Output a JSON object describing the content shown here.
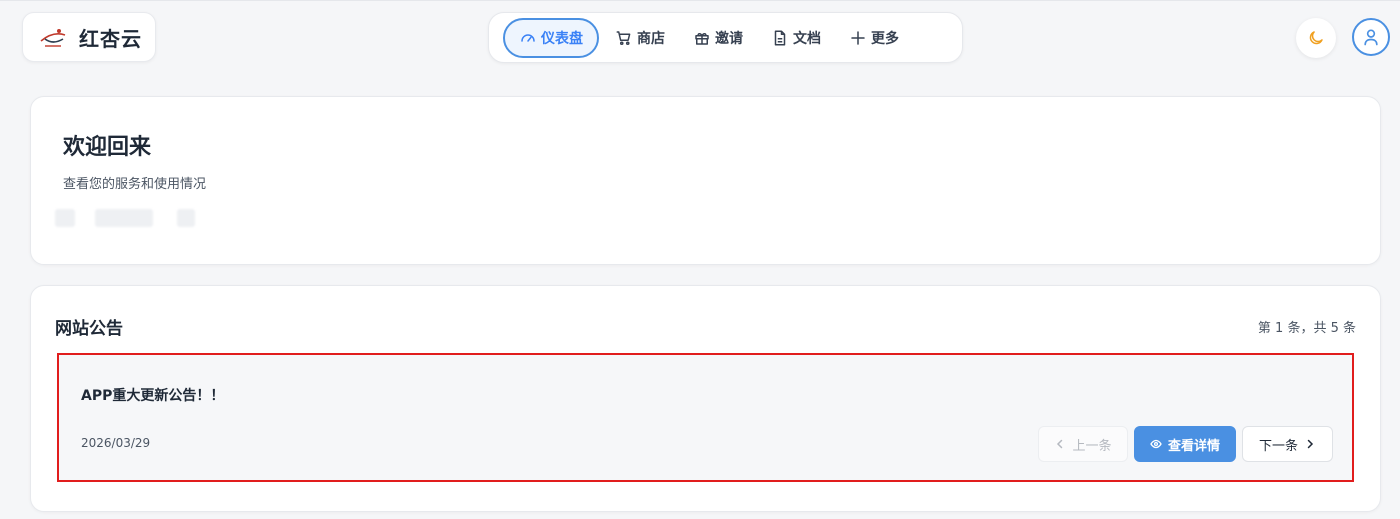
{
  "app": {
    "name": "红杏云"
  },
  "nav": {
    "items": [
      {
        "label": "仪表盘",
        "icon": "gauge-icon",
        "active": true
      },
      {
        "label": "商店",
        "icon": "cart-icon",
        "active": false
      },
      {
        "label": "邀请",
        "icon": "gift-icon",
        "active": false
      },
      {
        "label": "文档",
        "icon": "document-icon",
        "active": false
      },
      {
        "label": "更多",
        "icon": "plus-icon",
        "active": false
      }
    ]
  },
  "header": {
    "theme_icon": "moon-icon",
    "user_icon": "user-icon"
  },
  "welcome": {
    "title": "欢迎回来",
    "subtitle": "查看您的服务和使用情况"
  },
  "notice": {
    "title": "网站公告",
    "pagination": "第 1 条，共 5 条",
    "item": {
      "title": "APP重大更新公告！！",
      "date": "2026/03/29"
    },
    "prev_label": "上一条",
    "view_label": "查看详情",
    "next_label": "下一条"
  },
  "colors": {
    "accent": "#4a90e2",
    "highlight_border": "#e11d1d",
    "moon": "#f0a020"
  }
}
